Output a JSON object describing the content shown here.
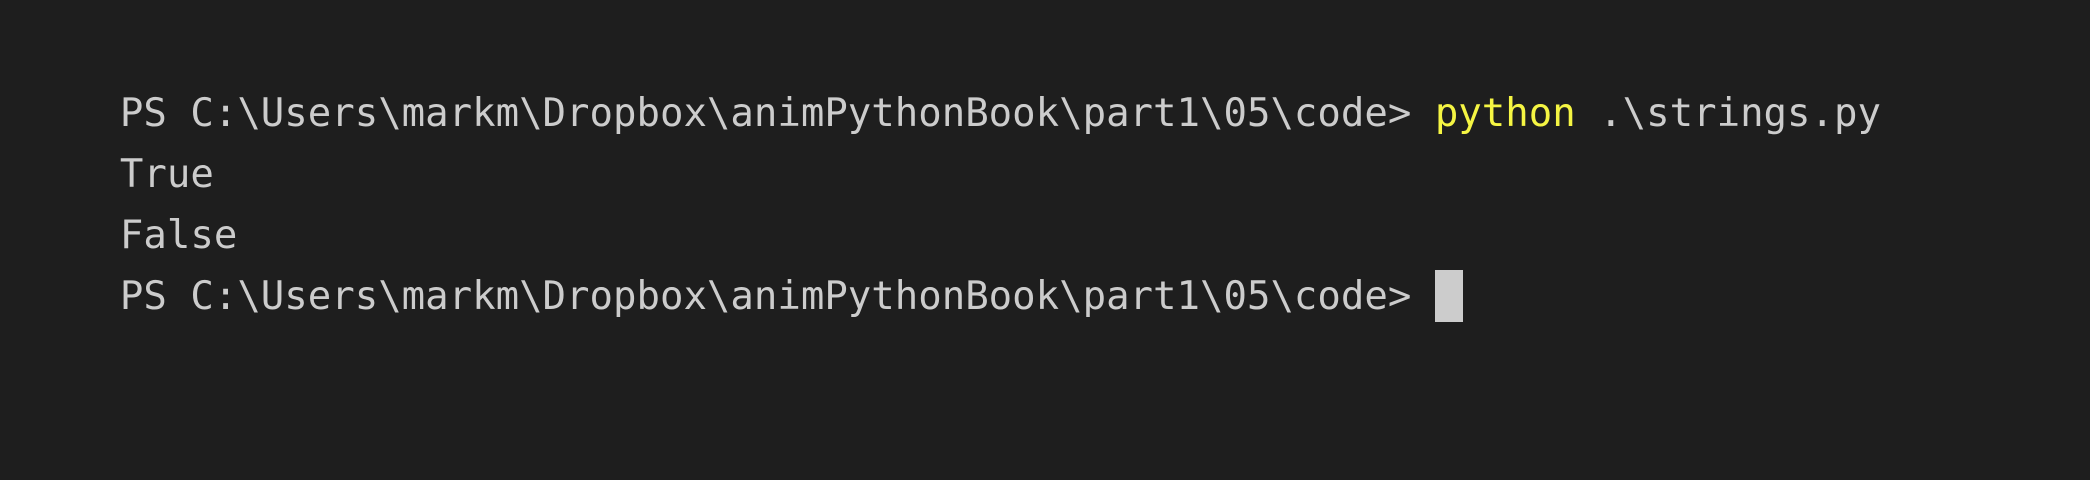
{
  "terminal": {
    "lines": [
      {
        "prompt": "PS C:\\Users\\markm\\Dropbox\\animPythonBook\\part1\\05\\code> ",
        "command": "python",
        "args": " .\\strings.py"
      },
      {
        "text": "True"
      },
      {
        "text": "False"
      },
      {
        "prompt": "PS C:\\Users\\markm\\Dropbox\\animPythonBook\\part1\\05\\code> "
      }
    ]
  },
  "colors": {
    "background": "#1e1e1e",
    "text": "#cccccc",
    "command": "#f5f543"
  }
}
